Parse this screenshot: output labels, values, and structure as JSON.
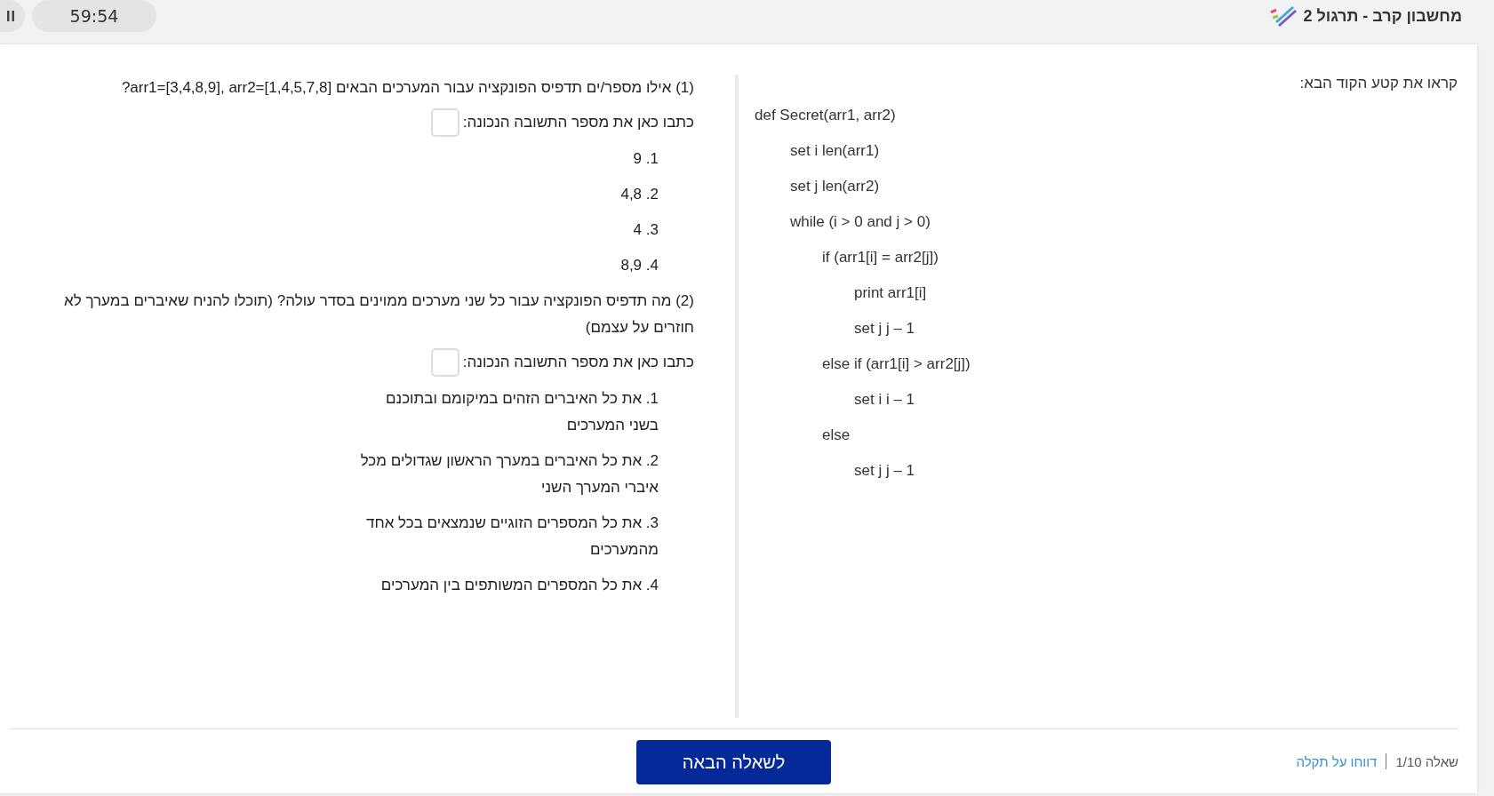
{
  "header": {
    "timer": "59:54",
    "title": "מחשבון קרב - תרגול 2"
  },
  "code_panel": {
    "heading": "קראו את קטע הקוד הבא:",
    "code": [
      {
        "text": "def Secret(arr1, arr2)",
        "children": [
          {
            "text": "set i len(arr1)"
          },
          {
            "text": "set j len(arr2)"
          },
          {
            "text": "while (i > 0 and j > 0)",
            "children": [
              {
                "text": "if (arr1[i] = arr2[j])",
                "children": [
                  {
                    "text": "print arr1[i]"
                  },
                  {
                    "text": "set j j – 1"
                  }
                ]
              },
              {
                "text": "else if (arr1[i] > arr2[j])",
                "children": [
                  {
                    "text": "set i i – 1"
                  }
                ]
              },
              {
                "text": "else",
                "children": [
                  {
                    "text": "set j j – 1"
                  }
                ]
              }
            ]
          }
        ]
      }
    ]
  },
  "questions": [
    {
      "text": "(1) אילו מספר/ים תדפיס הפונקציה עבור המערכים הבאים arr1=[3,4,8,9], arr2=[1,4,5,7,8]?",
      "answer_prompt": "כתבו כאן את מספר התשובה הנכונה:",
      "options": [
        "1. 9",
        "2. 4,8",
        "3. 4",
        "4. 8,9"
      ]
    },
    {
      "text": "(2) מה תדפיס הפונקציה עבור כל שני מערכים ממוינים בסדר עולה? (תוכלו להניח שאיברים במערך לא חוזרים על עצמם)",
      "answer_prompt": "כתבו כאן את מספר התשובה הנכונה:",
      "options": [
        "1. את כל האיברים הזהים במיקומם ובתוכנם בשני המערכים",
        "2. את כל האיברים במערך הראשון שגדולים מכל איברי המערך השני",
        "3. את כל המספרים הזוגיים שנמצאים בכל אחד מהמערכים",
        "4. את כל המספרים המשותפים בין המערכים"
      ]
    }
  ],
  "footer": {
    "next_button": "לשאלה הבאה",
    "progress": "שאלה 1/10",
    "report_link": "דווחו על תקלה"
  }
}
